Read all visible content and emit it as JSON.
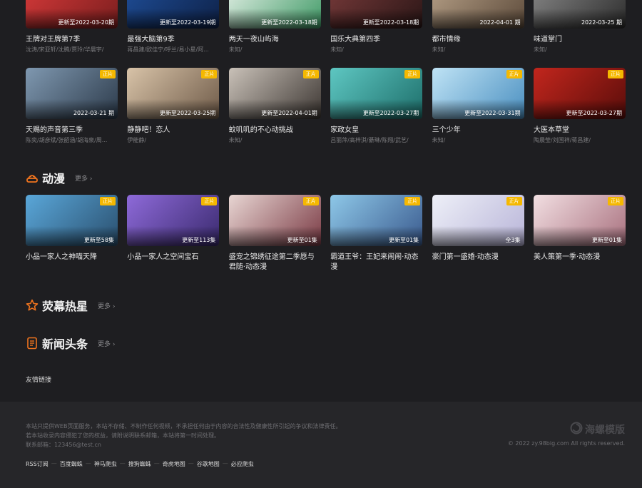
{
  "row1": [
    {
      "title": "王牌对王牌第7季",
      "cast": "沈涛/宋亚轩/沈腾/贾玲/华晨宇/",
      "note": "更新至2022-03-20期",
      "badge": "",
      "colors": [
        "#d83a3a",
        "#7a1e1e"
      ]
    },
    {
      "title": "最强大脑第9季",
      "cast": "蒋昌建/欧佳宁/呼兰/易小星/阿...",
      "note": "更新至2022-03-19期",
      "badge": "",
      "colors": [
        "#1f4f9a",
        "#0e2147"
      ]
    },
    {
      "title": "两天一夜山屿海",
      "cast": "未知/",
      "note": "更新至2022-03-18期",
      "badge": "",
      "colors": [
        "#e9f2ea",
        "#3f9a66"
      ]
    },
    {
      "title": "国乐大典第四季",
      "cast": "未知/",
      "note": "更新至2022-03-18期",
      "badge": "",
      "colors": [
        "#7a3b3b",
        "#2a1616"
      ]
    },
    {
      "title": "都市情缘",
      "cast": "未知/",
      "note": "2022-04-01 期",
      "badge": "",
      "colors": [
        "#b9a38a",
        "#5c4a3a"
      ]
    },
    {
      "title": "味道掌门",
      "cast": "未知/",
      "note": "2022-03-25 期",
      "badge": "",
      "colors": [
        "#8a8a8a",
        "#2c2c2c"
      ]
    }
  ],
  "row2": [
    {
      "title": "天赐的声音第三季",
      "cast": "陈奕/胡彦斌/张韶涵/胡海泉/周...",
      "note": "2022-03-21 期",
      "badge": "正片",
      "colors": [
        "#7f98b0",
        "#2c3a4a"
      ]
    },
    {
      "title": "静静吧！恋人",
      "cast": "伊能静/",
      "note": "更新至2022-03-25期",
      "badge": "正片",
      "colors": [
        "#d8c3a8",
        "#6e5a48"
      ]
    },
    {
      "title": "蚊叽叽的不心动挑战",
      "cast": "未知/",
      "note": "更新至2022-04-01期",
      "badge": "正片",
      "colors": [
        "#c9c1b8",
        "#3c3632"
      ]
    },
    {
      "title": "家政女皇",
      "cast": "吕丽萍/高梓淇/綦琳/陈翔/武艺/",
      "note": "更新至2022-03-27期",
      "badge": "正片",
      "colors": [
        "#5ec7c2",
        "#1d6e6a"
      ]
    },
    {
      "title": "三个少年",
      "cast": "未知/",
      "note": "更新至2022-03-31期",
      "badge": "正片",
      "colors": [
        "#bfe3f5",
        "#4a8fc0"
      ]
    },
    {
      "title": "大医本草堂",
      "cast": "陶晨莹/刘国祥/蒋昌建/",
      "note": "更新至2022-03-27期",
      "badge": "正片",
      "colors": [
        "#c2261d",
        "#5a0d0a"
      ]
    }
  ],
  "sections": {
    "anime": {
      "name": "动漫",
      "more": "更多"
    },
    "stars": {
      "name": "荧幕热星",
      "more": "更多"
    },
    "news": {
      "name": "新闻头条",
      "more": "更多"
    }
  },
  "row3": [
    {
      "title": "小品一家人之神喵天降",
      "note": "更新至58集",
      "badge": "正片",
      "colors": [
        "#5aa7d9",
        "#2a4f6e"
      ]
    },
    {
      "title": "小品一家人之空间宝石",
      "note": "更新至113集",
      "badge": "正片",
      "colors": [
        "#8e6ad9",
        "#3a2a6e"
      ]
    },
    {
      "title": "盛宠之锦绣征途第二季愿与君随·动态漫",
      "note": "更新至01集",
      "badge": "正片",
      "colors": [
        "#e8d6d3",
        "#7a3a44"
      ]
    },
    {
      "title": "霸道王爷：王妃来闹闹·动态漫",
      "note": "更新至01集",
      "badge": "正片",
      "colors": [
        "#8ec8e8",
        "#3a5a8e"
      ]
    },
    {
      "title": "豪门第一盛婚·动态漫",
      "note": "全3集",
      "badge": "正片",
      "colors": [
        "#eef0f8",
        "#b8b4d8"
      ]
    },
    {
      "title": "美人策第一季·动态漫",
      "note": "更新至01集",
      "badge": "正片",
      "colors": [
        "#f2dfe2",
        "#a8707e"
      ]
    }
  ],
  "friend_links_label": "友情链接",
  "footer": {
    "disclaimer": "本站只提供WEB页面服务，本站不存储、不制作任何视频，不承担任何由于内容的合法性及健康性所引起的争议和法律责任。",
    "rights": "若本站收录内容侵犯了您的权益，请附说明联系邮箱，本站将第一时间处理。",
    "email": "联系邮箱：123456@test.cn",
    "logo_text": "海螺模版",
    "copyright": "© 2022 zy.98big.com All rights reserved.",
    "links": [
      "RSS订阅",
      "百度蜘蛛",
      "神马爬虫",
      "搜狗蜘蛛",
      "奇虎地图",
      "谷歌地图",
      "必应爬虫"
    ]
  }
}
